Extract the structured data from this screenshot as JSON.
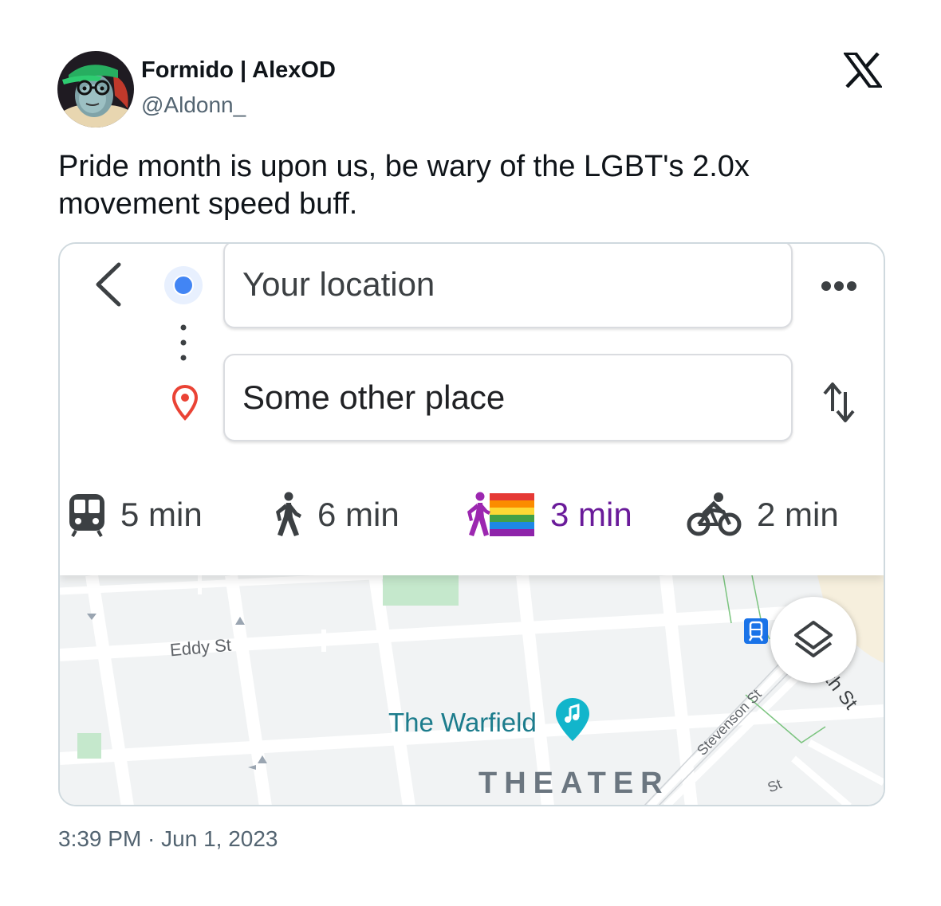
{
  "tweet": {
    "author": {
      "display_name": "Formido | AlexOD",
      "handle": "@Aldonn_"
    },
    "text": "Pride month is upon us, be wary of the LGBT's 2.0x movement speed buff.",
    "timestamp": "3:39 PM · Jun 1, 2023",
    "platform_icon": "x-logo-icon"
  },
  "directions": {
    "origin": {
      "value": "Your location"
    },
    "destination": {
      "value": "Some other place"
    },
    "modes": [
      {
        "name": "transit",
        "icon": "train-icon",
        "time": "5 min",
        "selected": false
      },
      {
        "name": "walking",
        "icon": "walking-person-icon",
        "time": "6 min",
        "selected": false
      },
      {
        "name": "pride",
        "icon": "walking-person-rainbow-flag-icon",
        "time": "3 min",
        "selected": true
      },
      {
        "name": "cycling",
        "icon": "bicycle-icon",
        "time": "2 min",
        "selected": false
      }
    ]
  },
  "map": {
    "streets": [
      "Eddy St",
      "Stevenson St",
      "th St",
      "St"
    ],
    "poi": {
      "name": "The Warfield",
      "icon": "music-note-pin-icon"
    },
    "area_label": "THEATER",
    "controls": {
      "layers": "layers-icon"
    }
  },
  "colors": {
    "accent_selected": "#6a1b9a",
    "origin_dot": "#4285f4",
    "destination_pin": "#ea4335",
    "poi_teal": "#1c7c8c"
  }
}
